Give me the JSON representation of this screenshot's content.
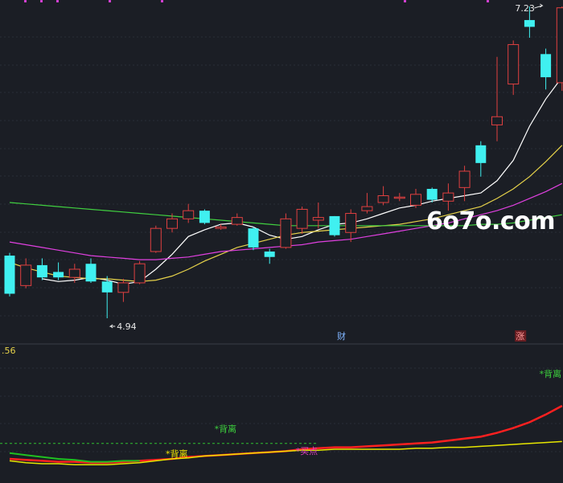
{
  "chart_data": {
    "type": "candlestick",
    "price_high_label": "7.23",
    "price_low_label": "4.94",
    "candles": [
      {
        "o": 5.4,
        "h": 5.42,
        "l": 5.1,
        "c": 5.12
      },
      {
        "o": 5.18,
        "h": 5.38,
        "l": 5.16,
        "c": 5.33
      },
      {
        "o": 5.33,
        "h": 5.38,
        "l": 5.22,
        "c": 5.24
      },
      {
        "o": 5.28,
        "h": 5.35,
        "l": 5.22,
        "c": 5.24
      },
      {
        "o": 5.24,
        "h": 5.34,
        "l": 5.2,
        "c": 5.3
      },
      {
        "o": 5.34,
        "h": 5.38,
        "l": 5.2,
        "c": 5.21
      },
      {
        "o": 5.21,
        "h": 5.25,
        "l": 4.94,
        "c": 5.13
      },
      {
        "o": 5.13,
        "h": 5.23,
        "l": 5.06,
        "c": 5.2
      },
      {
        "o": 5.2,
        "h": 5.36,
        "l": 5.19,
        "c": 5.34
      },
      {
        "o": 5.43,
        "h": 5.62,
        "l": 5.42,
        "c": 5.6
      },
      {
        "o": 5.6,
        "h": 5.71,
        "l": 5.57,
        "c": 5.67
      },
      {
        "o": 5.67,
        "h": 5.78,
        "l": 5.64,
        "c": 5.73
      },
      {
        "o": 5.73,
        "h": 5.74,
        "l": 5.63,
        "c": 5.64
      },
      {
        "o": 5.6,
        "h": 5.63,
        "l": 5.59,
        "c": 5.61
      },
      {
        "o": 5.63,
        "h": 5.71,
        "l": 5.62,
        "c": 5.68
      },
      {
        "o": 5.6,
        "h": 5.61,
        "l": 5.44,
        "c": 5.46
      },
      {
        "o": 5.43,
        "h": 5.45,
        "l": 5.34,
        "c": 5.39
      },
      {
        "o": 5.46,
        "h": 5.71,
        "l": 5.45,
        "c": 5.67
      },
      {
        "o": 5.6,
        "h": 5.76,
        "l": 5.56,
        "c": 5.74
      },
      {
        "o": 5.66,
        "h": 5.79,
        "l": 5.6,
        "c": 5.68
      },
      {
        "o": 5.69,
        "h": 5.69,
        "l": 5.54,
        "c": 5.55
      },
      {
        "o": 5.57,
        "h": 5.74,
        "l": 5.5,
        "c": 5.71
      },
      {
        "o": 5.73,
        "h": 5.86,
        "l": 5.71,
        "c": 5.76
      },
      {
        "o": 5.79,
        "h": 5.91,
        "l": 5.77,
        "c": 5.84
      },
      {
        "o": 5.83,
        "h": 5.86,
        "l": 5.8,
        "c": 5.83
      },
      {
        "o": 5.77,
        "h": 5.89,
        "l": 5.75,
        "c": 5.85
      },
      {
        "o": 5.89,
        "h": 5.9,
        "l": 5.79,
        "c": 5.81
      },
      {
        "o": 5.8,
        "h": 5.93,
        "l": 5.73,
        "c": 5.86
      },
      {
        "o": 5.9,
        "h": 6.06,
        "l": 5.8,
        "c": 6.02
      },
      {
        "o": 6.21,
        "h": 6.24,
        "l": 5.98,
        "c": 6.08
      },
      {
        "o": 6.36,
        "h": 6.86,
        "l": 6.24,
        "c": 6.42
      },
      {
        "o": 6.66,
        "h": 6.98,
        "l": 6.58,
        "c": 6.95
      },
      {
        "o": 7.13,
        "h": 7.23,
        "l": 7.0,
        "c": 7.08
      },
      {
        "o": 6.88,
        "h": 6.92,
        "l": 6.62,
        "c": 6.71
      },
      {
        "o": 6.67,
        "h": 7.23,
        "l": 6.61,
        "c": 7.22
      }
    ],
    "moving_averages": [
      {
        "color": "#ffffff",
        "values": [
          null,
          null,
          5.23,
          5.21,
          5.22,
          5.24,
          5.22,
          5.19,
          5.21,
          5.3,
          5.41,
          5.54,
          5.59,
          5.63,
          5.64,
          5.61,
          5.55,
          5.52,
          5.54,
          5.59,
          5.63,
          5.64,
          5.67,
          5.71,
          5.75,
          5.77,
          5.8,
          5.82,
          5.84,
          5.86,
          5.95,
          6.1,
          6.35,
          6.55,
          6.71
        ]
      },
      {
        "color": "#e6d24a",
        "values": [
          5.35,
          5.31,
          5.28,
          5.25,
          5.24,
          5.23,
          5.23,
          5.22,
          5.21,
          5.22,
          5.25,
          5.3,
          5.36,
          5.41,
          5.46,
          5.49,
          5.52,
          5.55,
          5.57,
          5.58,
          5.59,
          5.6,
          5.61,
          5.62,
          5.63,
          5.65,
          5.67,
          5.7,
          5.73,
          5.76,
          5.82,
          5.89,
          5.98,
          6.09,
          6.21
        ]
      },
      {
        "color": "#e040e0",
        "values": [
          5.5,
          5.48,
          5.46,
          5.44,
          5.42,
          5.4,
          5.39,
          5.38,
          5.37,
          5.37,
          5.38,
          5.39,
          5.41,
          5.43,
          5.44,
          5.45,
          5.46,
          5.47,
          5.48,
          5.5,
          5.51,
          5.52,
          5.54,
          5.56,
          5.58,
          5.6,
          5.62,
          5.64,
          5.67,
          5.7,
          5.73,
          5.77,
          5.82,
          5.87,
          5.93
        ]
      },
      {
        "color": "#40d040",
        "values": [
          5.79,
          5.78,
          5.77,
          5.76,
          5.75,
          5.74,
          5.73,
          5.72,
          5.71,
          5.7,
          5.69,
          5.68,
          5.67,
          5.66,
          5.65,
          5.64,
          5.63,
          5.62,
          5.62,
          5.62,
          5.62,
          5.62,
          5.62,
          5.62,
          5.62,
          5.62,
          5.62,
          5.62,
          5.62,
          5.63,
          5.63,
          5.64,
          5.66,
          5.68,
          5.7
        ]
      }
    ],
    "markers": [
      {
        "candle": 20,
        "text": "财",
        "class": "tag-cai"
      },
      {
        "candle": 31,
        "text": "涨",
        "class": "tag-zhang"
      }
    ],
    "indicator": {
      "value_label": ".56",
      "lines": [
        {
          "color": "#ff2020",
          "width": 2.5,
          "values": [
            0.2,
            0.19,
            0.18,
            0.17,
            0.17,
            0.16,
            0.16,
            0.17,
            0.18,
            0.19,
            0.2,
            0.22,
            0.23,
            0.24,
            0.25,
            0.26,
            0.27,
            0.28,
            0.3,
            0.31,
            0.32,
            0.32,
            0.33,
            0.34,
            0.35,
            0.36,
            0.37,
            0.39,
            0.41,
            0.43,
            0.47,
            0.52,
            0.58,
            0.66,
            0.75
          ]
        },
        {
          "color": "#e6e600",
          "width": 1.5,
          "values": [
            0.18,
            0.16,
            0.15,
            0.15,
            0.14,
            0.14,
            0.14,
            0.15,
            0.16,
            0.18,
            0.2,
            0.21,
            0.23,
            0.24,
            0.25,
            0.26,
            0.27,
            0.28,
            0.29,
            0.29,
            0.3,
            0.3,
            0.3,
            0.3,
            0.3,
            0.31,
            0.31,
            0.32,
            0.32,
            0.33,
            0.34,
            0.35,
            0.36,
            0.37,
            0.38
          ]
        },
        {
          "color": "#20c020",
          "width": 2,
          "values": [
            0.26,
            0.24,
            0.22,
            0.2,
            0.19,
            0.17,
            0.17,
            0.18,
            0.18,
            null,
            null,
            null,
            null,
            null,
            null,
            null,
            null,
            null,
            null,
            null,
            null,
            null,
            null,
            null,
            null,
            null,
            null,
            null,
            null,
            null,
            null,
            null,
            null,
            null,
            null
          ]
        }
      ],
      "dashed_line": {
        "color": "#30c030",
        "value": 0.36
      },
      "labels": [
        {
          "text": "*背离",
          "class": "sig-green",
          "candle": 13,
          "value": 0.48
        },
        {
          "text": "*背离",
          "class": "sig-yellow",
          "candle": 10,
          "value": 0.22
        },
        {
          "text": "*买点",
          "class": "sig-magenta",
          "candle": 18,
          "value": 0.25
        },
        {
          "text": "*背离",
          "class": "sig-green",
          "candle": 33,
          "value": 1.05
        }
      ]
    }
  },
  "watermark": "6o7o.com",
  "colors": {
    "up": "#e04040",
    "down": "#40f0f0",
    "bg": "#1b1e25",
    "grid": "#2a2f38"
  }
}
